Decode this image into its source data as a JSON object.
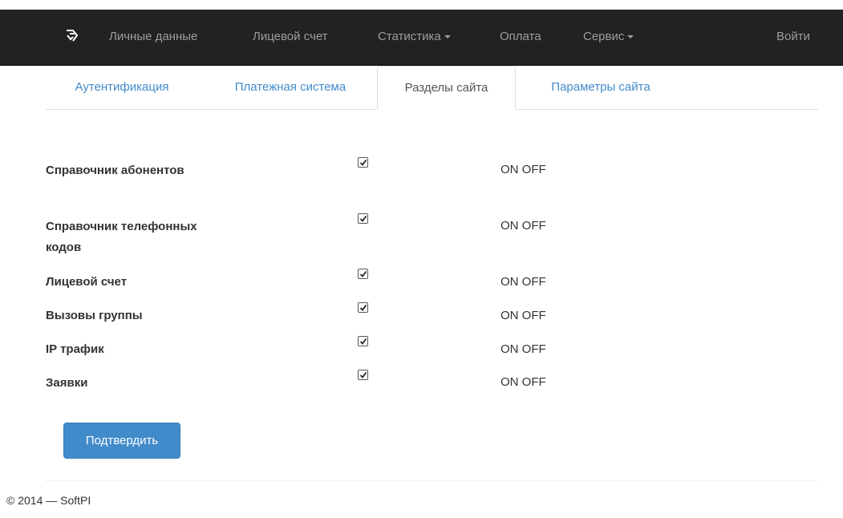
{
  "navbar": {
    "brand_icon": "arrows-brand-icon",
    "items": [
      {
        "label": "Личные данные"
      },
      {
        "label": "Лицевой счет"
      },
      {
        "label": "Статистика"
      },
      {
        "label": "Оплата"
      },
      {
        "label": "Сервис"
      }
    ],
    "login_label": "Войти"
  },
  "tabs": [
    {
      "label": "Аутентификация",
      "active": false
    },
    {
      "label": "Платежная система",
      "active": false
    },
    {
      "label": "Разделы сайта",
      "active": true
    },
    {
      "label": "Параметры сайта",
      "active": false
    }
  ],
  "sections": [
    {
      "label": "Справочник абонентов",
      "checked": true,
      "toggle_label": "ON OFF"
    },
    {
      "label": "Справочник телефонных кодов",
      "checked": true,
      "toggle_label": "ON OFF"
    },
    {
      "label": "Лицевой счет",
      "checked": true,
      "toggle_label": "ON OFF"
    },
    {
      "label": "Вызовы группы",
      "checked": true,
      "toggle_label": "ON OFF"
    },
    {
      "label": "IP трафик",
      "checked": true,
      "toggle_label": "ON OFF"
    },
    {
      "label": "Заявки",
      "checked": true,
      "toggle_label": "ON OFF"
    }
  ],
  "submit_label": "Подтвердить",
  "footer": {
    "text": "© 2014 — SoftPI"
  },
  "colors": {
    "navbar_bg": "#222222",
    "link": "#428bca",
    "primary_button": "#428bca"
  }
}
